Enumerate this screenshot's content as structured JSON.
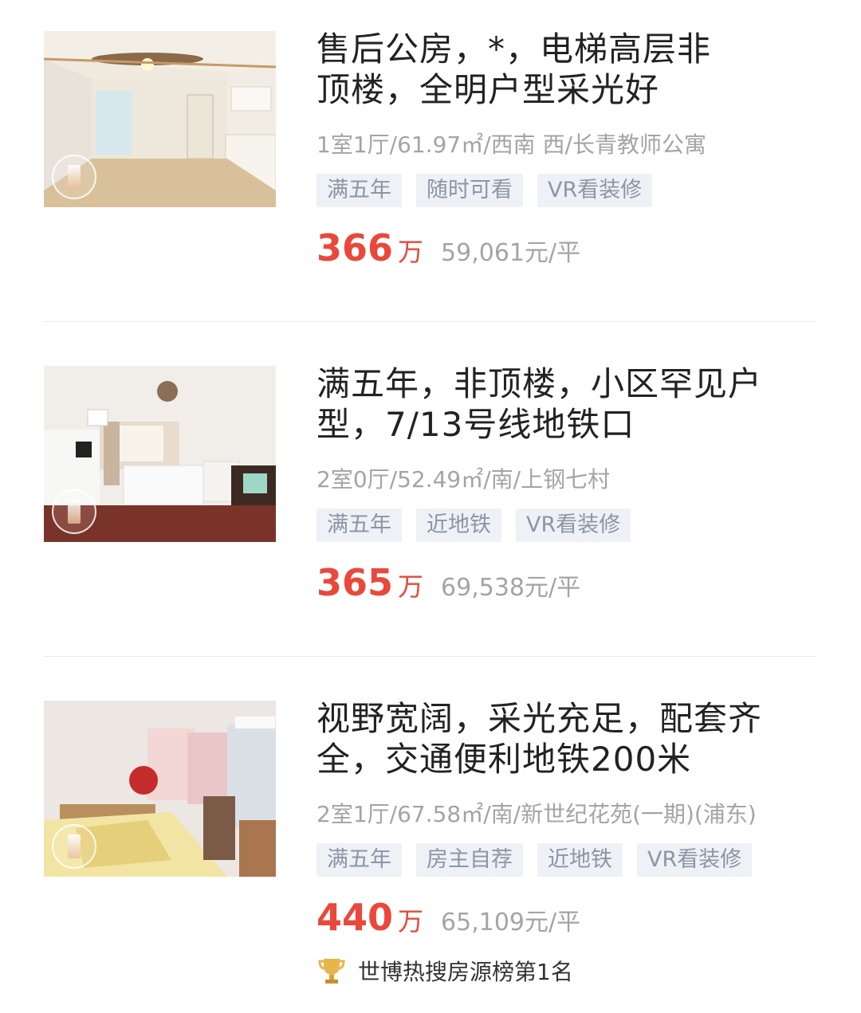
{
  "listings": [
    {
      "title_line1": "售后公房，*，电梯高层非",
      "title_line2": "顶楼，全明户型采光好",
      "meta": "1室1厅/61.97㎡/西南 西/长青教师公寓",
      "tags": [
        "满五年",
        "随时可看",
        "VR看装修"
      ],
      "price": "366",
      "price_unit": "万",
      "unit_price": "59,061元/平"
    },
    {
      "title_line1": "满五年，非顶楼，小区罕见户",
      "title_line2": "型，7/13号线地铁口",
      "meta": "2室0厅/52.49㎡/南/上钢七村",
      "tags": [
        "满五年",
        "近地铁",
        "VR看装修"
      ],
      "price": "365",
      "price_unit": "万",
      "unit_price": "69,538元/平"
    },
    {
      "title_line1": "视野宽阔，采光充足，配套齐",
      "title_line2": "全，交通便利地铁200米",
      "meta": "2室1厅/67.58㎡/南/新世纪花苑(一期)(浦东)",
      "tags": [
        "满五年",
        "房主自荐",
        "近地铁",
        "VR看装修"
      ],
      "price": "440",
      "price_unit": "万",
      "unit_price": "65,109元/平",
      "rank_text": "世博热搜房源榜第1名"
    }
  ],
  "colors": {
    "price": "#e9483b",
    "tag_bg": "#eef1f5",
    "tag_text": "#8b96a6",
    "meta_text": "#a4a4a4"
  },
  "icons": [
    "vr-icon",
    "trophy-icon"
  ]
}
